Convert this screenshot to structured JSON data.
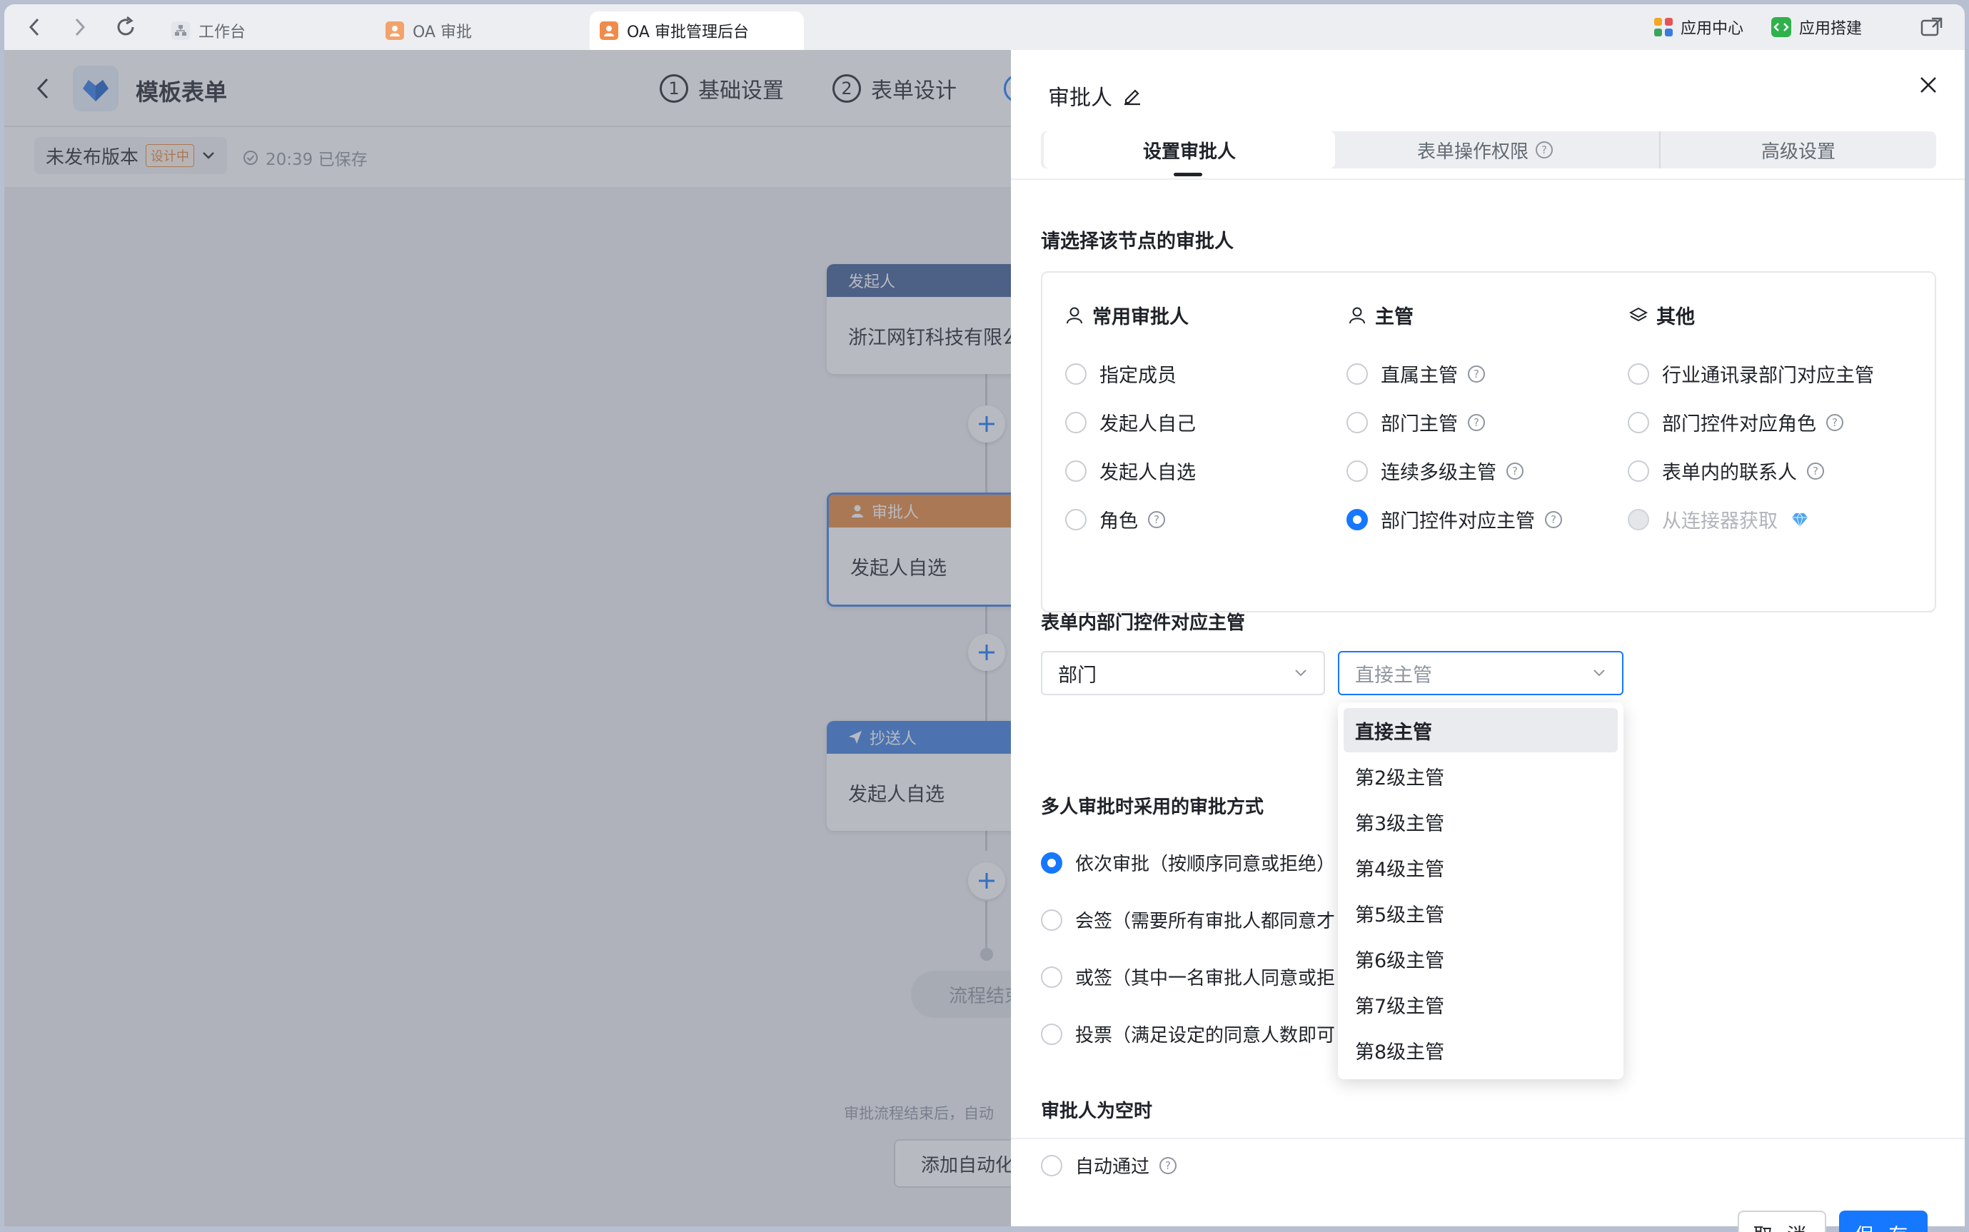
{
  "browser": {
    "tabs": [
      {
        "label": "工作台",
        "icon": "org-icon"
      },
      {
        "label": "OA 审批",
        "icon": "person-icon"
      },
      {
        "label": "OA 审批管理后台",
        "icon": "person-icon"
      }
    ],
    "app_center": "应用中心",
    "app_builder": "应用搭建"
  },
  "header": {
    "title": "模板表单",
    "steps": [
      {
        "num": "1",
        "label": "基础设置"
      },
      {
        "num": "2",
        "label": "表单设计"
      }
    ],
    "version": "未发布版本",
    "version_badge": "设计中",
    "saved": "20:39 已保存"
  },
  "flow": {
    "nodes": [
      {
        "type": "发起人",
        "body": "浙江网钉科技有限公",
        "color": "#3f5b93"
      },
      {
        "type": "审批人",
        "body": "发起人自选",
        "color": "#e8873a"
      },
      {
        "type": "抄送人",
        "body": "发起人自选",
        "color": "#3d7fe0"
      }
    ],
    "end_label": "流程结束",
    "footer_note": "审批流程结束后，自动",
    "automation_button": "添加自动化"
  },
  "drawer": {
    "title": "审批人",
    "tabs": [
      "设置审批人",
      "表单操作权限",
      "高级设置"
    ],
    "select_title": "请选择该节点的审批人",
    "columns": [
      {
        "title": "常用审批人",
        "icon": "person-icon",
        "options": [
          {
            "label": "指定成员",
            "help": false,
            "state": "off"
          },
          {
            "label": "发起人自己",
            "help": false,
            "state": "off"
          },
          {
            "label": "发起人自选",
            "help": false,
            "state": "off"
          },
          {
            "label": "角色",
            "help": true,
            "state": "off"
          }
        ]
      },
      {
        "title": "主管",
        "icon": "person-icon",
        "options": [
          {
            "label": "直属主管",
            "help": true,
            "state": "off"
          },
          {
            "label": "部门主管",
            "help": true,
            "state": "off"
          },
          {
            "label": "连续多级主管",
            "help": true,
            "state": "off"
          },
          {
            "label": "部门控件对应主管",
            "help": true,
            "state": "on"
          }
        ]
      },
      {
        "title": "其他",
        "icon": "layers-icon",
        "options": [
          {
            "label": "行业通讯录部门对应主管",
            "help": false,
            "state": "off"
          },
          {
            "label": "部门控件对应角色",
            "help": true,
            "state": "off"
          },
          {
            "label": "表单内的联系人",
            "help": true,
            "state": "off"
          },
          {
            "label": "从连接器获取",
            "help": false,
            "state": "disabled"
          }
        ]
      }
    ],
    "dept_section_title": "表单内部门控件对应主管",
    "dept_select_value": "部门",
    "manager_select_placeholder": "直接主管",
    "manager_options": [
      "直接主管",
      "第2级主管",
      "第3级主管",
      "第4级主管",
      "第5级主管",
      "第6级主管",
      "第7级主管",
      "第8级主管"
    ],
    "multi_title": "多人审批时采用的审批方式",
    "multi_options": [
      "依次审批（按顺序同意或拒绝）",
      "会签（需要所有审批人都同意才",
      "或签（其中一名审批人同意或拒",
      "投票（满足设定的同意人数即可"
    ],
    "empty_title": "审批人为空时",
    "empty_option": "自动通过",
    "cancel": "取 消",
    "save": "保 存"
  },
  "colors": {
    "accent": "#1677ff",
    "selected_radio": "#1677ff"
  }
}
